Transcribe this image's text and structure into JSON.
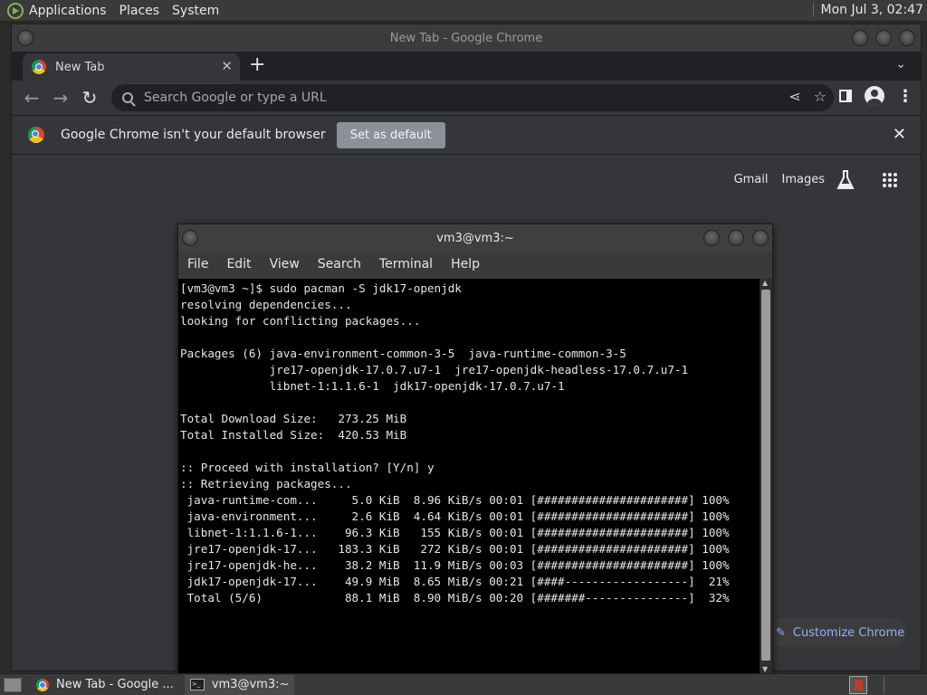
{
  "top_panel": {
    "menus": [
      "Applications",
      "Places",
      "System"
    ],
    "clock": "Mon Jul 3, 02:47"
  },
  "chrome": {
    "window_title": "New Tab - Google Chrome",
    "tab_title": "New Tab",
    "omnibox_placeholder": "Search Google or type a URL",
    "infobar_text": "Google Chrome isn't your default browser",
    "set_default_label": "Set as default",
    "ntp_links": [
      "Gmail",
      "Images"
    ],
    "customize_label": "Customize Chrome"
  },
  "terminal": {
    "title": "vm3@vm3:~",
    "menus": [
      "File",
      "Edit",
      "View",
      "Search",
      "Terminal",
      "Help"
    ],
    "lines": [
      "[vm3@vm3 ~]$ sudo pacman -S jdk17-openjdk",
      "resolving dependencies...",
      "looking for conflicting packages...",
      "",
      "Packages (6) java-environment-common-3-5  java-runtime-common-3-5",
      "             jre17-openjdk-17.0.7.u7-1  jre17-openjdk-headless-17.0.7.u7-1",
      "             libnet-1:1.1.6-1  jdk17-openjdk-17.0.7.u7-1",
      "",
      "Total Download Size:   273.25 MiB",
      "Total Installed Size:  420.53 MiB",
      "",
      ":: Proceed with installation? [Y/n] y",
      ":: Retrieving packages...",
      " java-runtime-com...     5.0 KiB  8.96 KiB/s 00:01 [######################] 100%",
      " java-environment...     2.6 KiB  4.64 KiB/s 00:01 [######################] 100%",
      " libnet-1:1.1.6-1...    96.3 KiB   155 KiB/s 00:01 [######################] 100%",
      " jre17-openjdk-17...   183.3 KiB   272 KiB/s 00:01 [######################] 100%",
      " jre17-openjdk-he...    38.2 MiB  11.9 MiB/s 00:03 [######################] 100%",
      " jdk17-openjdk-17...    49.9 MiB  8.65 MiB/s 00:21 [####------------------]  21%",
      " Total (5/6)            88.1 MiB  8.90 MiB/s 00:20 [#######---------------]  32%"
    ]
  },
  "taskbar": {
    "tasks": [
      "New Tab - Google ...",
      "vm3@vm3:~"
    ]
  }
}
